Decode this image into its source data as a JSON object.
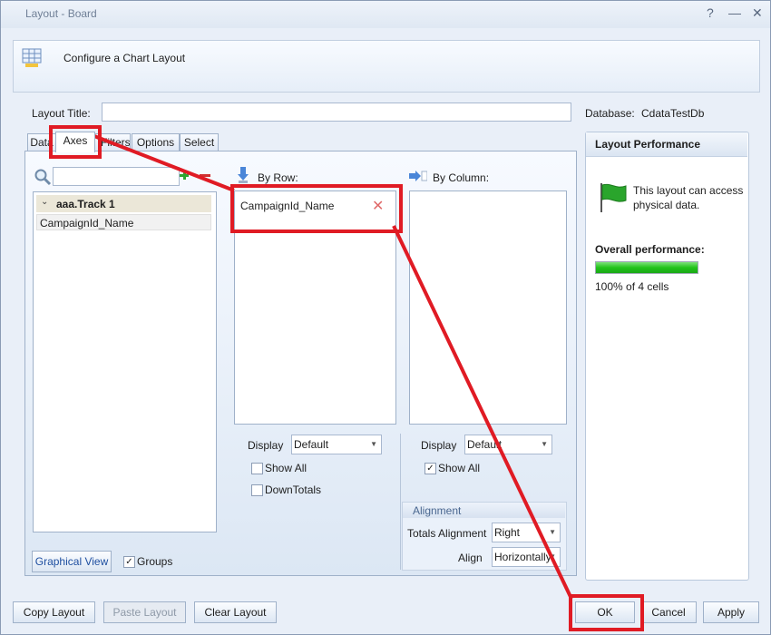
{
  "window": {
    "title": "Layout - Board",
    "controls": [
      "?",
      "—",
      "✕"
    ]
  },
  "header": {
    "text": "Configure a Chart Layout"
  },
  "layout_title": {
    "label": "Layout Title:",
    "value": ""
  },
  "database": {
    "label": "Database:",
    "value": "CdataTestDb"
  },
  "tabs": [
    {
      "label": "Data"
    },
    {
      "label": "Axes"
    },
    {
      "label": "Filters"
    },
    {
      "label": "Options"
    },
    {
      "label": "Select"
    }
  ],
  "fields": {
    "search_value": "",
    "group": "aaa.Track 1",
    "items": [
      "CampaignId_Name"
    ]
  },
  "by_row": {
    "label": "By Row:",
    "items": [
      "CampaignId_Name"
    ],
    "display_label": "Display",
    "display_value": "Default",
    "show_all": "Show All",
    "show_all_checked": false,
    "down_totals": "DownTotals",
    "down_totals_checked": false
  },
  "by_column": {
    "label": "By Column:",
    "items": [],
    "display_label": "Display",
    "display_value": "Default",
    "show_all": "Show All",
    "show_all_checked": true
  },
  "alignment": {
    "title": "Alignment",
    "totals_label": "Totals Alignment",
    "totals_value": "Right",
    "align_label": "Align",
    "align_value": "Horizontally"
  },
  "graphical_view": "Graphical View",
  "groups": {
    "label": "Groups",
    "checked": true
  },
  "performance": {
    "title": "Layout Performance",
    "message": "This layout can access physical data.",
    "overall_label": "Overall performance:",
    "progress": 1.0,
    "summary": "100% of 4 cells"
  },
  "buttons": {
    "copy": "Copy Layout",
    "paste": "Paste Layout",
    "clear": "Clear Layout",
    "ok": "OK",
    "cancel": "Cancel",
    "apply": "Apply"
  },
  "colors": {
    "accent": "#e01b24",
    "progress": "#22c41a"
  }
}
